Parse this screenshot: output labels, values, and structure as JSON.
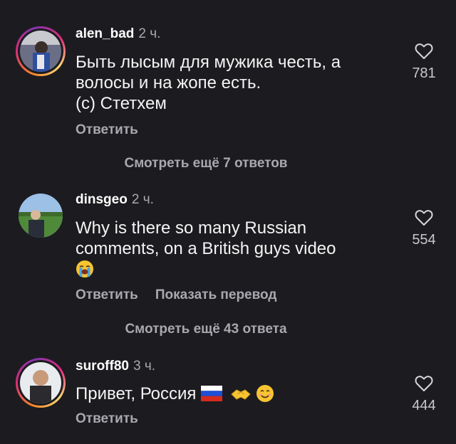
{
  "comments": [
    {
      "username": "alen_bad",
      "time": "2 ч.",
      "text_lines": [
        "Быть лысым для мужика честь, а",
        "волосы и на жопе есть.",
        "(с) Стетхем"
      ],
      "likes": "781",
      "actions": [
        "Ответить"
      ]
    },
    {
      "username": "dinsgeo",
      "time": "2 ч.",
      "text_lines": [
        "Why is there so many Russian",
        "comments, on a British guys video"
      ],
      "emoji": "loudly-crying-face",
      "likes": "554",
      "actions": [
        "Ответить",
        "Показать перевод"
      ]
    },
    {
      "username": "suroff80",
      "time": "3 ч.",
      "text": "Привет, Россия",
      "emojis": [
        "russia-flag",
        "handshake",
        "smiling-face"
      ],
      "likes": "444",
      "actions": [
        "Ответить"
      ]
    }
  ],
  "view_more": [
    "Смотреть ещё 7 ответов",
    "Смотреть ещё 43 ответа"
  ],
  "colors": {
    "background": "#1c1c20",
    "secondary_text": "#a8a8ae",
    "story_ring": [
      "#f58529",
      "#dd2a7b",
      "#8134af"
    ]
  }
}
